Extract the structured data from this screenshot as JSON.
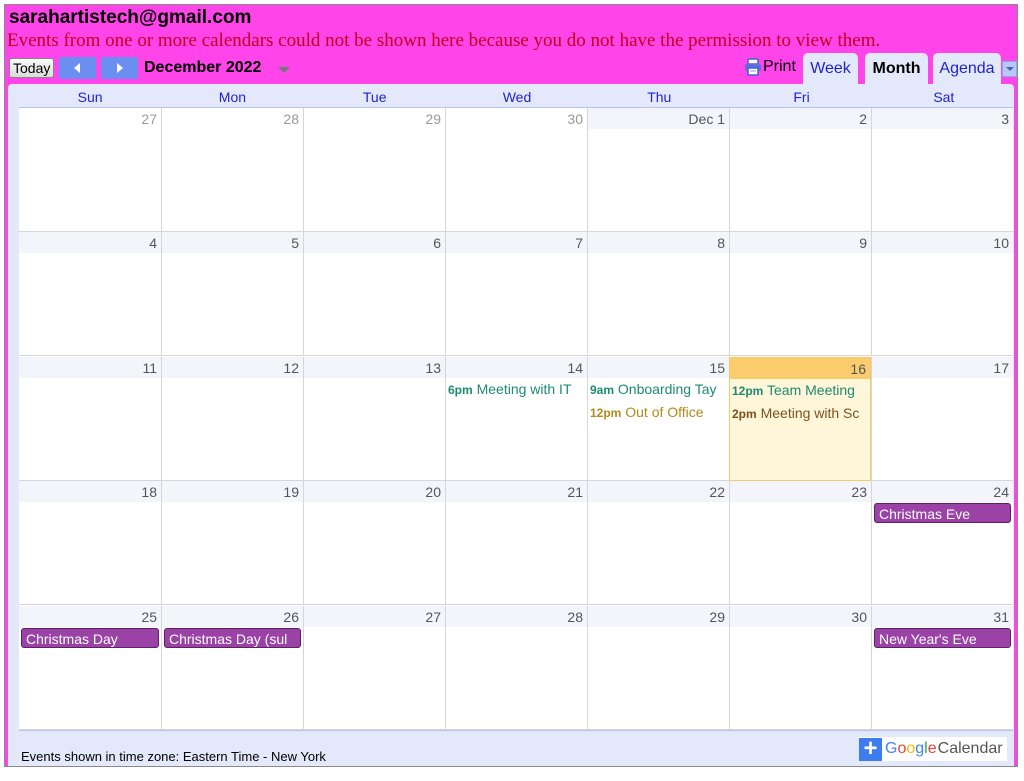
{
  "header": {
    "account": "sarahartistech@gmail.com",
    "warning": "Events from one or more calendars could not be shown here because you do not have the permission to view them."
  },
  "toolbar": {
    "today_label": "Today",
    "prev_icon": "chevron-left-icon",
    "next_icon": "chevron-right-icon",
    "month_label": "December 2022",
    "print_label": "Print",
    "tabs": [
      {
        "label": "Week",
        "active": false
      },
      {
        "label": "Month",
        "active": true
      },
      {
        "label": "Agenda",
        "active": false
      }
    ]
  },
  "calendar": {
    "weekdays": [
      "Sun",
      "Mon",
      "Tue",
      "Wed",
      "Thu",
      "Fri",
      "Sat"
    ],
    "weeks": [
      [
        {
          "label": "27",
          "other": true
        },
        {
          "label": "28",
          "other": true
        },
        {
          "label": "29",
          "other": true
        },
        {
          "label": "30",
          "other": true
        },
        {
          "label": "Dec 1"
        },
        {
          "label": "2"
        },
        {
          "label": "3"
        }
      ],
      [
        {
          "label": "4"
        },
        {
          "label": "5"
        },
        {
          "label": "6"
        },
        {
          "label": "7"
        },
        {
          "label": "8"
        },
        {
          "label": "9"
        },
        {
          "label": "10"
        }
      ],
      [
        {
          "label": "11"
        },
        {
          "label": "12"
        },
        {
          "label": "13"
        },
        {
          "label": "14",
          "events": [
            {
              "time": "6pm",
              "title": "Meeting with IT",
              "color": "teal"
            }
          ]
        },
        {
          "label": "15",
          "events": [
            {
              "time": "9am",
              "title": "Onboarding Tay",
              "color": "teal"
            },
            {
              "time": "12pm",
              "title": "Out of Office",
              "color": "gold"
            }
          ]
        },
        {
          "label": "16",
          "today": true,
          "events": [
            {
              "time": "12pm",
              "title": "Team Meeting",
              "color": "teal"
            },
            {
              "time": "2pm",
              "title": "Meeting with Sc",
              "color": "brown"
            }
          ]
        },
        {
          "label": "17"
        }
      ],
      [
        {
          "label": "18"
        },
        {
          "label": "19"
        },
        {
          "label": "20"
        },
        {
          "label": "21"
        },
        {
          "label": "22"
        },
        {
          "label": "23"
        },
        {
          "label": "24",
          "allday": [
            "Christmas Eve"
          ]
        }
      ],
      [
        {
          "label": "25",
          "allday": [
            "Christmas Day"
          ]
        },
        {
          "label": "26",
          "allday": [
            "Christmas Day (sul"
          ]
        },
        {
          "label": "27"
        },
        {
          "label": "28"
        },
        {
          "label": "29"
        },
        {
          "label": "30"
        },
        {
          "label": "31",
          "allday": [
            "New Year's Eve"
          ]
        }
      ]
    ]
  },
  "footer": {
    "timezone": "Events shown in time zone: Eastern Time - New York",
    "badge_plus": "+",
    "badge_google": [
      "G",
      "o",
      "o",
      "g",
      "l",
      "e"
    ],
    "badge_calendar": "Calendar"
  },
  "colors": {
    "header_bg": "#ff44ea",
    "warning_text": "#c3001f",
    "today_bg": "#fff6d9",
    "allday_event": "#9a42a6",
    "timed_teal": "#1d8a72",
    "timed_gold": "#b08a1a",
    "timed_brown": "#7a521f"
  }
}
